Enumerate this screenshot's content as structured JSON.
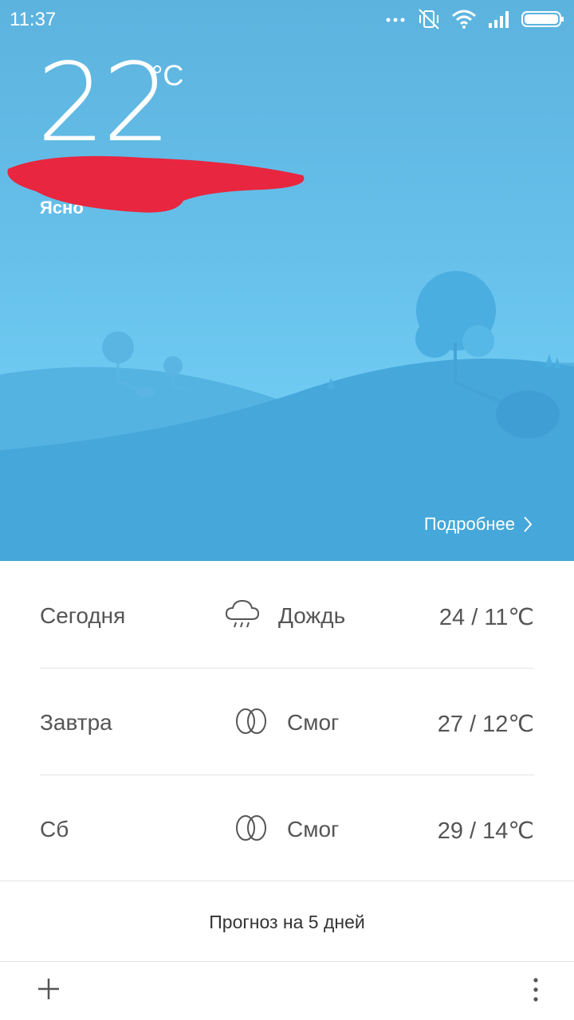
{
  "status_bar": {
    "time": "11:37",
    "icons": [
      "more-dots-icon",
      "vibrate-mute-icon",
      "wifi-icon",
      "signal-icon",
      "battery-icon"
    ]
  },
  "current": {
    "temperature": "22",
    "unit": "°C",
    "condition": "Ясно"
  },
  "hero": {
    "more_label": "Подробнее"
  },
  "forecast": [
    {
      "day": "Сегодня",
      "icon": "rain-icon",
      "condition": "Дождь",
      "temps": "24 / 11℃"
    },
    {
      "day": "Завтра",
      "icon": "smog-icon",
      "condition": "Смог",
      "temps": "27 / 12℃"
    },
    {
      "day": "Сб",
      "icon": "smog-icon",
      "condition": "Смог",
      "temps": "29 / 14℃"
    }
  ],
  "five_day_label": "Прогноз на 5 дней",
  "bottom_bar": {
    "add_icon": "plus-icon",
    "menu_icon": "more-vertical-icon"
  },
  "colors": {
    "sky_top": "#5cb3de",
    "sky_bottom": "#6fcaf2",
    "hill": "#4aa8da",
    "redaction": "#e8263f",
    "text_gray": "#555555"
  }
}
